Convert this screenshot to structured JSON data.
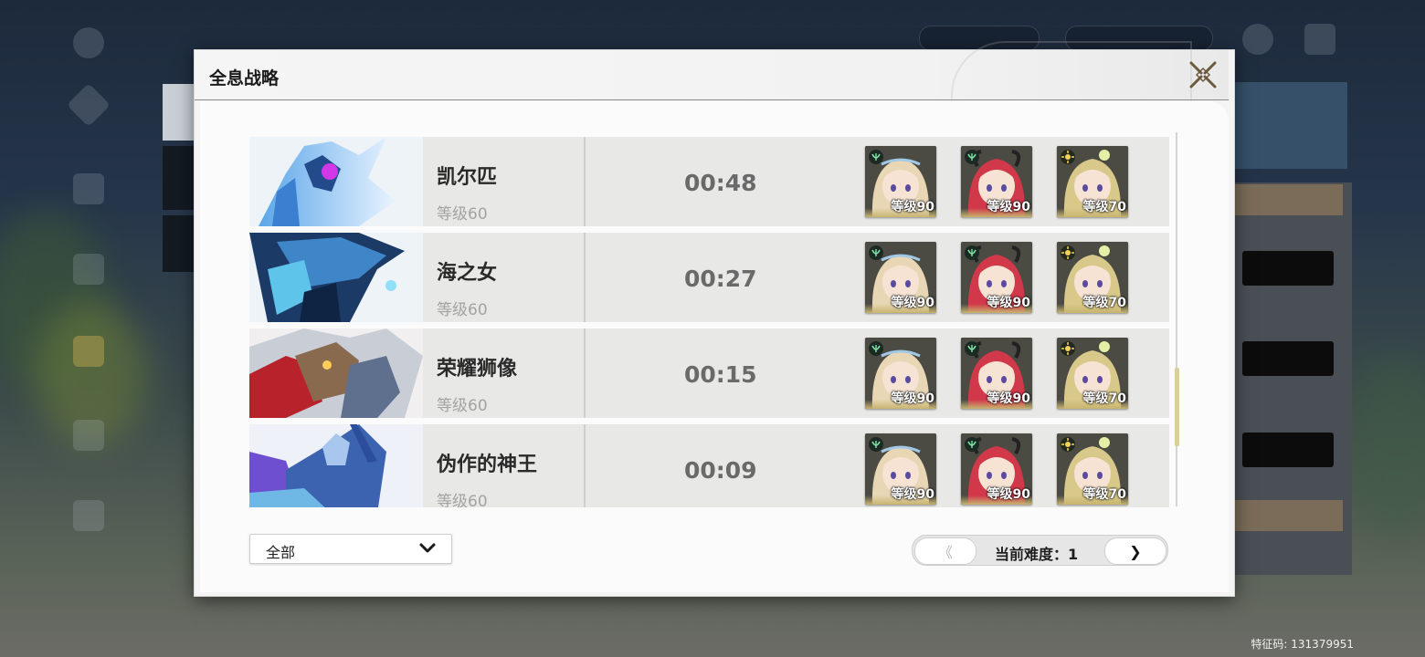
{
  "window": {
    "title": "全息战略",
    "close_icon": "close-x-icon"
  },
  "boss_rows": [
    {
      "name": "凯尔匹",
      "level": "等级60",
      "clear_time": "00:48",
      "team": [
        {
          "level": "等级90",
          "element": "wind",
          "hair": "#e8d6b4"
        },
        {
          "level": "等级90",
          "element": "wind",
          "hair": "#d1384a"
        },
        {
          "level": "等级70",
          "element": "light",
          "hair": "#d8c98a"
        }
      ]
    },
    {
      "name": "海之女",
      "level": "等级60",
      "clear_time": "00:27",
      "team": [
        {
          "level": "等级90",
          "element": "wind",
          "hair": "#e8d6b4"
        },
        {
          "level": "等级90",
          "element": "wind",
          "hair": "#d1384a"
        },
        {
          "level": "等级70",
          "element": "light",
          "hair": "#d8c98a"
        }
      ]
    },
    {
      "name": "荣耀狮像",
      "level": "等级60",
      "clear_time": "00:15",
      "team": [
        {
          "level": "等级90",
          "element": "wind",
          "hair": "#e8d6b4"
        },
        {
          "level": "等级90",
          "element": "wind",
          "hair": "#d1384a"
        },
        {
          "level": "等级70",
          "element": "light",
          "hair": "#d8c98a"
        }
      ]
    },
    {
      "name": "伪作的神王",
      "level": "等级60",
      "clear_time": "00:09",
      "team": [
        {
          "level": "等级90",
          "element": "wind",
          "hair": "#e8d6b4"
        },
        {
          "level": "等级90",
          "element": "wind",
          "hair": "#d1384a"
        },
        {
          "level": "等级70",
          "element": "light",
          "hair": "#d8c98a"
        }
      ]
    }
  ],
  "filter": {
    "selected": "全部",
    "icon": "chevron-down-icon"
  },
  "pager": {
    "prev_label": "《",
    "next_label": "❯",
    "difficulty_label": "当前难度：1"
  },
  "watermark": "特征码: 131379951",
  "colors": {
    "row_bg": "#e8e8e6",
    "scroll_thumb": "#d9cf98",
    "time_text": "#6a6a6a"
  }
}
